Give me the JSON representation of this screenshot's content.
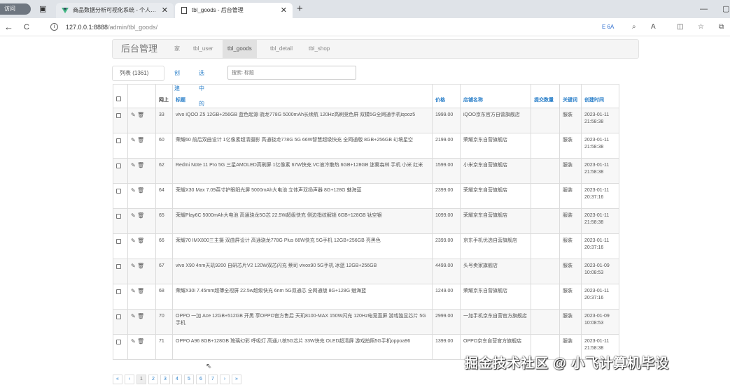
{
  "browser": {
    "tab_stub_label": "访问",
    "tabs": [
      {
        "label": "商品数据分析可视化系统 - 个人…"
      },
      {
        "label": "tbl_goods - 后台管理"
      }
    ],
    "new_tab": "+",
    "back": "←",
    "reload": "C",
    "url_host": "127.0.0.1:8888",
    "url_path": "/admin/tbl_goods/",
    "toolbar_ext": "E 6A",
    "window_min": "—",
    "window_max": "▢"
  },
  "nav": {
    "brand": "后台管理",
    "items": [
      {
        "label": "家"
      },
      {
        "label": "tbl_user"
      },
      {
        "label": "tbl_goods"
      },
      {
        "label": "tbl_detail"
      },
      {
        "label": "tbl_shop"
      }
    ],
    "active_index": 2
  },
  "list": {
    "title": "列表 (1361)",
    "create": "创建",
    "selected": "选中的 ▾",
    "search_placeholder": "搜索: 标题"
  },
  "table": {
    "headers": [
      "",
      "",
      "网上",
      "标题",
      "价格",
      "店铺名称",
      "提交数量",
      "关键词",
      "创建时间"
    ],
    "rows": [
      {
        "id": "33",
        "title": "vivo iQOO Z5 12GB+256GB 蓝色起源 骁龙778G 5000mAh长续航 120Hz高刷竞色屏 双模5G全网通手机iqooz5",
        "price": "1999.00",
        "shop": "iQOO京东官方自营旗舰店",
        "count": "",
        "keyword": "服装",
        "created": "2023-01-11 21:58:38"
      },
      {
        "id": "60",
        "title": "荣耀60 前后双曲设计 1亿像素超清摄影 高通骁龙778G 5G 66W智慧超级快充 全网通版 8GB+256GB 幻境星空",
        "price": "2199.00",
        "shop": "荣耀京东自营旗舰店",
        "count": "",
        "keyword": "服装",
        "created": "2023-01-11 21:58:38"
      },
      {
        "id": "62",
        "title": "Redmi Note 11 Pro 5G 三星AMOLED高刷屏 1亿像素 67W快充 VC液冷散热 6GB+128GB 迷雾森林 手机 小米 红米",
        "price": "1599.00",
        "shop": "小米京东自营旗舰店",
        "count": "",
        "keyword": "服装",
        "created": "2023-01-11 21:58:38"
      },
      {
        "id": "64",
        "title": "荣耀X30 Max 7.09英寸护眼阳光屏 5000mAh大电池 立体声双扬声器 8G+128G 魅海蓝",
        "price": "2399.00",
        "shop": "荣耀京东自营旗舰店",
        "count": "",
        "keyword": "服装",
        "created": "2023-01-11 20:37:16"
      },
      {
        "id": "65",
        "title": "荣耀Play6C 5000mAh大电池 高通骁龙5G芯 22.5W超级快充 侧边指纹解锁 6GB+128GB 钛空银",
        "price": "1099.00",
        "shop": "荣耀京东自营旗舰店",
        "count": "",
        "keyword": "服装",
        "created": "2023-01-11 21:58:38"
      },
      {
        "id": "66",
        "title": "荣耀70 IMX800三主摄 双曲屏设计 高通骁龙778G Plus 66W快充 5G手机 12GB+256GB 亮黑色",
        "price": "2399.00",
        "shop": "京东手机优选自营旗舰店",
        "count": "",
        "keyword": "服装",
        "created": "2023-01-11 20:37:16"
      },
      {
        "id": "67",
        "title": "vivo X90 4nm天玑9200 自研芯片V2 120W双芯闪充 蔡司 vivox90 5G手机 冰蓝 12GB+256GB",
        "price": "4499.00",
        "shop": "头号卖家旗舰店",
        "count": "",
        "keyword": "服装",
        "created": "2023-01-09 10:08:53"
      },
      {
        "id": "68",
        "title": "荣耀X30i 7.45mm超薄全视屏 22.5w超级快充 6nm 5G双通芯 全网通版 8G+128G 魅海蓝",
        "price": "1249.00",
        "shop": "荣耀京东自营旗舰店",
        "count": "",
        "keyword": "服装",
        "created": "2023-01-11 20:37:16"
      },
      {
        "id": "70",
        "title": "OPPO 一加 Ace 12GB+512GB 开黑 享OPPO官方售后 天玑8100-MAX 150W闪充 120Hz电竞直屏 游戏独显芯片 5G手机",
        "price": "2999.00",
        "shop": "一加手机京东自营官方旗舰店",
        "count": "",
        "keyword": "服装",
        "created": "2023-01-09 10:08:53"
      },
      {
        "id": "71",
        "title": "OPPO A96 8GB+128GB 琉璃幻彩 呼吸灯 高通八核5G芯片 33W快充 OLED超清屏 游戏拍照5G手机oppoa96",
        "price": "1399.00",
        "shop": "OPPO京东自营官方旗舰店",
        "count": "",
        "keyword": "服装",
        "created": "2023-01-11 21:58:38"
      }
    ]
  },
  "pager": [
    "«",
    "‹",
    "1",
    "2",
    "3",
    "4",
    "5",
    "6",
    "7",
    "›",
    "»"
  ],
  "pager_current": "1",
  "watermark": "掘金技术社区 @ 小飞计算机毕设",
  "icons": {
    "edit": "pencil-icon",
    "delete": "trash-icon"
  }
}
